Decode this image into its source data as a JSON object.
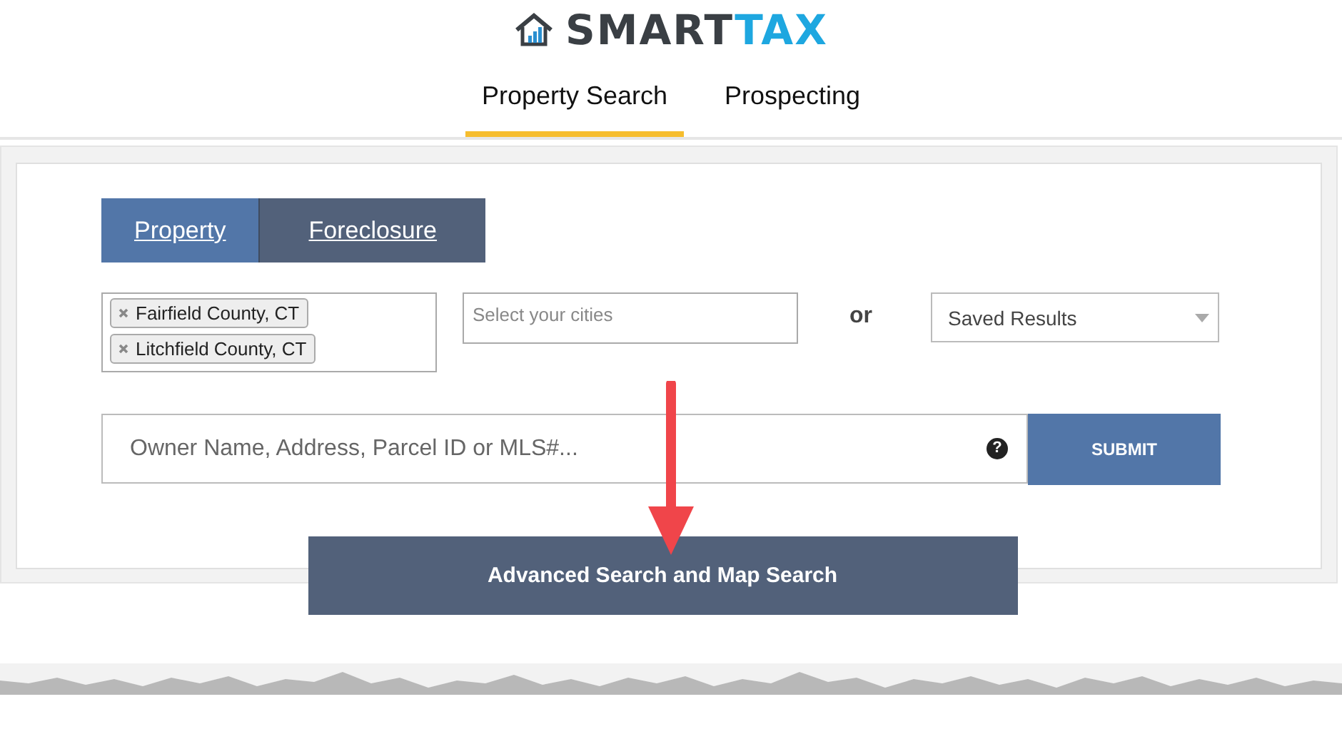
{
  "logo": {
    "brand_primary": "SMART",
    "brand_accent": "TAX"
  },
  "nav_tabs": [
    {
      "label": "Property Search",
      "selected": true
    },
    {
      "label": "Prospecting",
      "selected": false
    }
  ],
  "search_panel": {
    "mode_tabs": [
      {
        "label": "Property",
        "selected": true
      },
      {
        "label": "Foreclosure",
        "selected": false
      }
    ],
    "counties": [
      {
        "label": "Fairfield County, CT"
      },
      {
        "label": "Litchfield County, CT"
      }
    ],
    "cities": {
      "placeholder": "Select your cities"
    },
    "or_label": "or",
    "saved_results": {
      "value": "Saved Results"
    },
    "search": {
      "placeholder": "Owner Name, Address, Parcel ID or MLS#...",
      "help": "?"
    },
    "submit": "SUBMIT",
    "advanced_button": "Advanced Search and Map Search"
  }
}
